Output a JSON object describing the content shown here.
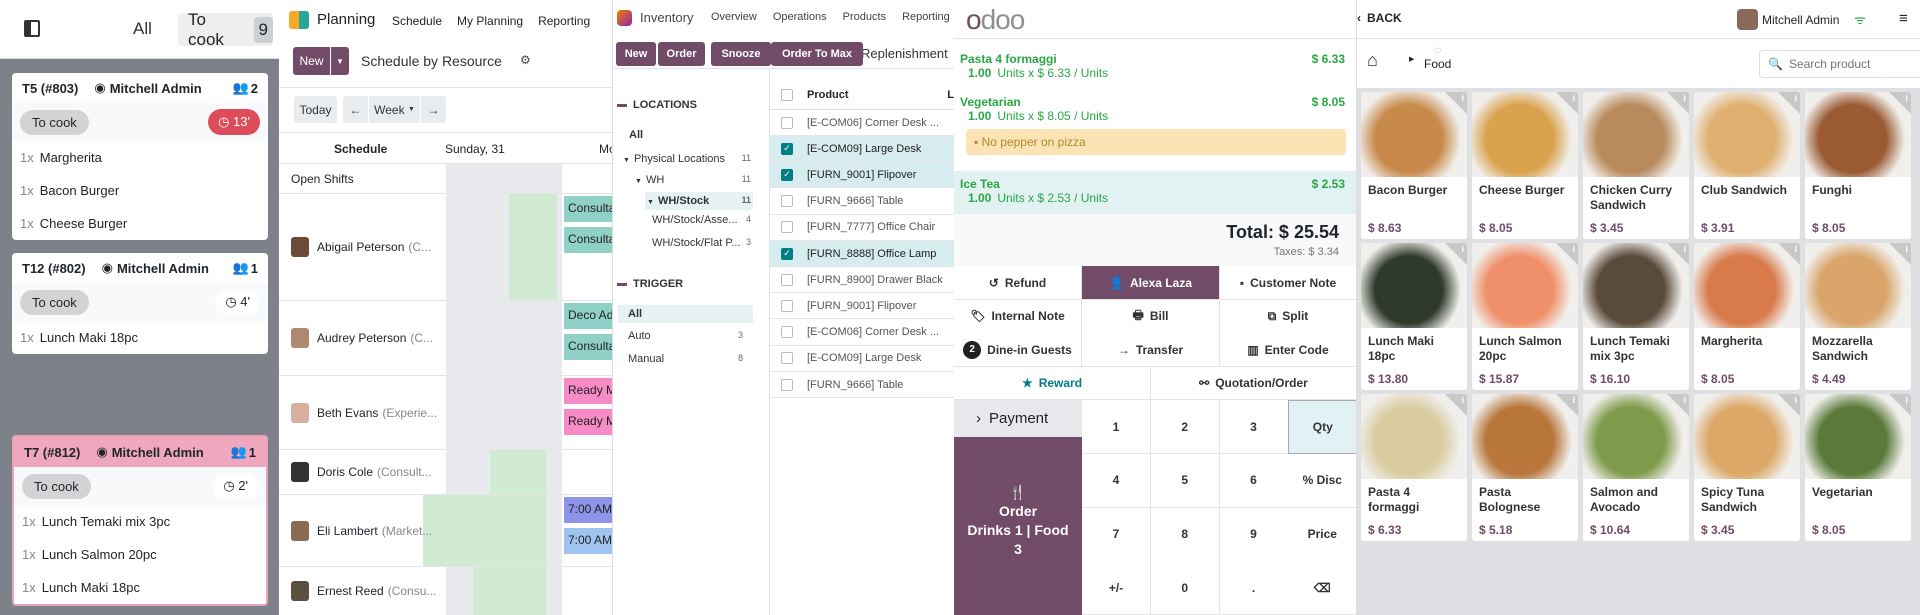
{
  "colors": {
    "brand": "#714b67",
    "late": "#dc4c5a",
    "pos_green": "#28a745",
    "selected_row": "#d6ecef"
  },
  "kitchen": {
    "sidebar_toggle_icon": "panel-left-icon",
    "filter_all": "All",
    "filter_to_cook": "To cook",
    "to_cook_count": "9",
    "tickets": [
      {
        "title": "T5 (#803)",
        "user": "Mitchell Admin",
        "guests": "2",
        "status": "To cook",
        "timer": "13'",
        "late_timer": true,
        "highlight": false,
        "items": [
          {
            "qty": "1x",
            "name": "Margherita"
          },
          {
            "qty": "1x",
            "name": "Bacon Burger"
          },
          {
            "qty": "1x",
            "name": "Cheese Burger"
          }
        ]
      },
      {
        "title": "T12 (#802)",
        "user": "Mitchell Admin",
        "guests": "1",
        "status": "To cook",
        "timer": "4'",
        "late_timer": false,
        "highlight": false,
        "items": [
          {
            "qty": "1x",
            "name": "Lunch Maki 18pc"
          }
        ]
      },
      {
        "title": "T7 (#812)",
        "user": "Mitchell Admin",
        "guests": "1",
        "status": "To cook",
        "timer": "2'",
        "late_timer": false,
        "highlight": true,
        "items": [
          {
            "qty": "1x",
            "name": "Lunch Temaki mix 3pc"
          },
          {
            "qty": "1x",
            "name": "Lunch Salmon 20pc"
          },
          {
            "qty": "1x",
            "name": "Lunch Maki 18pc"
          }
        ]
      }
    ]
  },
  "planning": {
    "app": "Planning",
    "menu": [
      "Schedule",
      "My Planning",
      "Reporting"
    ],
    "new": "New",
    "view_title": "Schedule by Resource",
    "today": "Today",
    "scale": "Week",
    "columns": [
      "Schedule",
      "Sunday, 31",
      "Mon"
    ],
    "open_shifts": "Open Shifts",
    "resources": [
      {
        "name": "Abigail Peterson",
        "role": "(C...",
        "events": [
          {
            "label": "Consulta",
            "color": "#8fd0c7"
          },
          {
            "label": "Consulta",
            "color": "#8fd0c7"
          }
        ]
      },
      {
        "name": "Audrey Peterson",
        "role": "(C...",
        "events": [
          {
            "label": "Deco Ad",
            "color": "#8fd0c7"
          },
          {
            "label": "Consulta",
            "color": "#8fd0c7"
          }
        ]
      },
      {
        "name": "Beth Evans",
        "role": "(Experie...",
        "events": [
          {
            "label": "Ready M",
            "color": "#f68bc6"
          },
          {
            "label": "Ready M",
            "color": "#f68bc6"
          }
        ]
      },
      {
        "name": "Doris Cole",
        "role": "(Consult...",
        "events": []
      },
      {
        "name": "Eli Lambert",
        "role": "(Market...",
        "events": [
          {
            "label": "7:00 AM",
            "color": "#8c95e8"
          },
          {
            "label": "7:00 AM",
            "color": "#a0c4f0"
          }
        ]
      },
      {
        "name": "Ernest Reed",
        "role": "(Consu...",
        "events": []
      }
    ]
  },
  "inventory": {
    "app": "Inventory",
    "menu": [
      "Overview",
      "Operations",
      "Products",
      "Reporting"
    ],
    "buttons": [
      "New",
      "Order",
      "Snooze",
      "Order To Max"
    ],
    "view_title": "Replenishment",
    "locations_heading": "LOCATIONS",
    "locations": [
      {
        "label": "All",
        "count": ""
      },
      {
        "label": "Physical Locations",
        "count": "11"
      },
      {
        "label": "WH",
        "count": "11"
      },
      {
        "label": "WH/Stock",
        "count": "11"
      },
      {
        "label": "WH/Stock/Asse...",
        "count": "4"
      },
      {
        "label": "WH/Stock/Flat P...",
        "count": "3"
      }
    ],
    "trigger_heading": "TRIGGER",
    "triggers": [
      {
        "label": "All",
        "count": ""
      },
      {
        "label": "Auto",
        "count": "3"
      },
      {
        "label": "Manual",
        "count": "8"
      }
    ],
    "column_product": "Product",
    "column_next": "L",
    "rows": [
      {
        "label": "[E-COM06] Corner Desk ...",
        "checked": false
      },
      {
        "label": "[E-COM09] Large Desk",
        "checked": true
      },
      {
        "label": "[FURN_9001] Flipover",
        "checked": true
      },
      {
        "label": "[FURN_9666] Table",
        "checked": false
      },
      {
        "label": "[FURN_7777] Office Chair",
        "checked": false
      },
      {
        "label": "[FURN_8888] Office Lamp",
        "checked": true
      },
      {
        "label": "[FURN_8900] Drawer Black",
        "checked": false
      },
      {
        "label": "[FURN_9001] Flipover",
        "checked": false
      },
      {
        "label": "[E-COM06] Corner Desk ...",
        "checked": false
      },
      {
        "label": "[E-COM09] Large Desk",
        "checked": false
      },
      {
        "label": "[FURN_9666] Table",
        "checked": false
      }
    ]
  },
  "pos": {
    "logo": "odoo",
    "lines": [
      {
        "name": "Pasta 4 formaggi",
        "price": "$ 6.33",
        "qty": "1.00",
        "detail": "Units x $ 6.33 / Units",
        "note": "",
        "selected": false
      },
      {
        "name": "Vegetarian",
        "price": "$ 8.05",
        "qty": "1.00",
        "detail": "Units x $ 8.05 / Units",
        "note": "No pepper on pizza",
        "selected": false
      },
      {
        "name": "Ice Tea",
        "price": "$ 2.53",
        "qty": "1.00",
        "detail": "Units x $ 2.53 / Units",
        "note": "",
        "selected": true
      }
    ],
    "total": "Total: $ 25.54",
    "taxes": "Taxes: $ 3.34",
    "actions": [
      {
        "label": "Refund",
        "icon": "undo-icon",
        "glyph": "↺"
      },
      {
        "label": "Alexa Laza",
        "icon": "user-icon",
        "glyph": "👤"
      },
      {
        "label": "Customer Note",
        "icon": "note-icon",
        "glyph": "▪"
      },
      {
        "label": "Internal Note",
        "icon": "tag-icon",
        "glyph": "🏷"
      },
      {
        "label": "Bill",
        "icon": "printer-icon",
        "glyph": "🖶"
      },
      {
        "label": "Split",
        "icon": "copy-icon",
        "glyph": "⧉"
      },
      {
        "label": "Dine-in Guests",
        "icon": "guests-badge",
        "glyph": "2"
      },
      {
        "label": "Transfer",
        "icon": "arrow-right-icon",
        "glyph": "→"
      },
      {
        "label": "Enter Code",
        "icon": "barcode-icon",
        "glyph": "▥"
      }
    ],
    "reward": "Reward",
    "quotation": "Quotation/Order",
    "payment": "Payment",
    "order_button": {
      "line1": "Order",
      "line2": "Drinks 1 | Food",
      "line3": "3"
    },
    "numpad": [
      "1",
      "2",
      "3",
      "Qty",
      "4",
      "5",
      "6",
      "% Disc",
      "7",
      "8",
      "9",
      "Price",
      "+/-",
      "0",
      ".",
      "⌫"
    ],
    "active_mode": "Qty"
  },
  "products": {
    "back": "BACK",
    "user": "Mitchell Admin",
    "category": "Food",
    "search_placeholder": "Search product",
    "items": [
      {
        "name": "Bacon Burger",
        "price": "$ 8.63",
        "color": "#c88a4a"
      },
      {
        "name": "Cheese Burger",
        "price": "$ 8.05",
        "color": "#d9a24c"
      },
      {
        "name": "Chicken Curry Sandwich",
        "price": "$ 3.45",
        "color": "#b88a5c"
      },
      {
        "name": "Club Sandwich",
        "price": "$ 3.91",
        "color": "#e0b070"
      },
      {
        "name": "Funghi",
        "price": "$ 8.05",
        "color": "#9a5a32"
      },
      {
        "name": "Lunch Maki 18pc",
        "price": "$ 13.80",
        "color": "#2f3a2a"
      },
      {
        "name": "Lunch Salmon 20pc",
        "price": "$ 15.87",
        "color": "#f0906a"
      },
      {
        "name": "Lunch Temaki mix 3pc",
        "price": "$ 16.10",
        "color": "#5a4a3a"
      },
      {
        "name": "Margherita",
        "price": "$ 8.05",
        "color": "#d87a4a"
      },
      {
        "name": "Mozzarella Sandwich",
        "price": "$ 4.49",
        "color": "#d9a56a"
      },
      {
        "name": "Pasta 4 formaggi",
        "price": "$ 6.33",
        "color": "#d8cca0"
      },
      {
        "name": "Pasta Bolognese",
        "price": "$ 5.18",
        "color": "#b8763a"
      },
      {
        "name": "Salmon and Avocado",
        "price": "$ 10.64",
        "color": "#7f9a4a"
      },
      {
        "name": "Spicy Tuna Sandwich",
        "price": "$ 3.45",
        "color": "#dca868"
      },
      {
        "name": "Vegetarian",
        "price": "$ 8.05",
        "color": "#5a7a3a"
      }
    ]
  }
}
